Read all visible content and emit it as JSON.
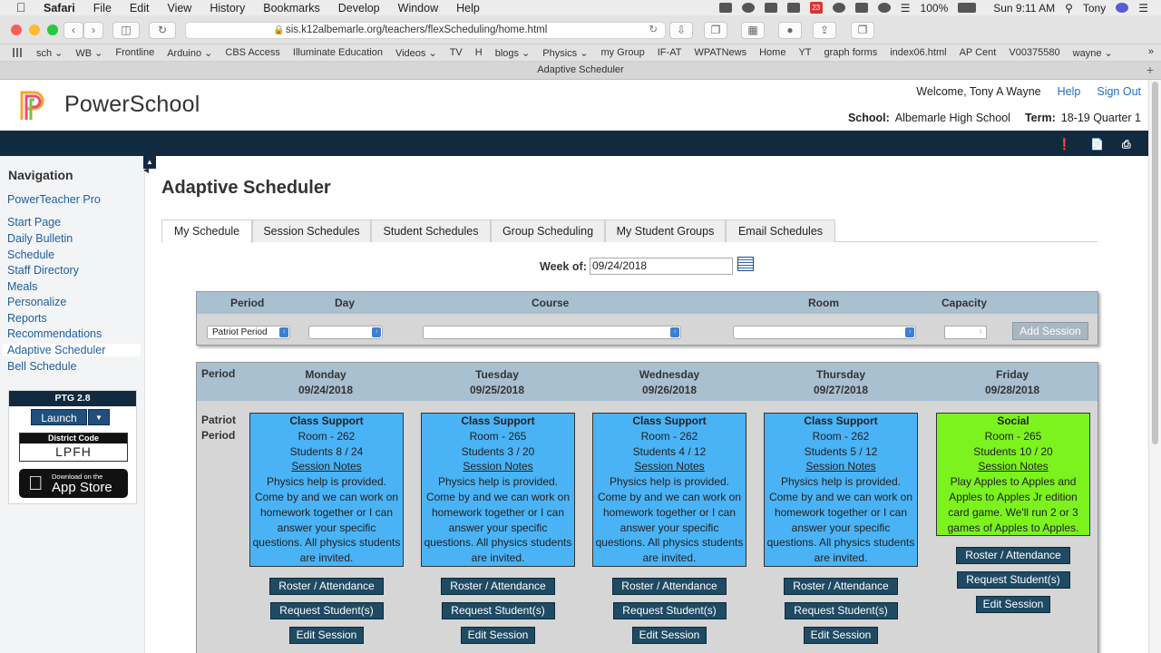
{
  "mac_menu": {
    "app": "Safari",
    "items": [
      "File",
      "Edit",
      "View",
      "History",
      "Bookmarks",
      "Develop",
      "Window",
      "Help"
    ],
    "battery": "100%",
    "clock": "Sun 9:11 AM",
    "user": "Tony",
    "calendar_day": "23"
  },
  "browser": {
    "url": "sis.k12albemarle.org/teachers/flexScheduling/home.html",
    "tab_title": "Adaptive Scheduler",
    "favorites": [
      "sch ⌄",
      "WB ⌄",
      "Frontline",
      "Arduino ⌄",
      "CBS Access",
      "Illuminate Education",
      "Videos ⌄",
      "TV",
      "H",
      "blogs ⌄",
      "Physics ⌄",
      "my Group",
      "IF-AT",
      "WPATNews",
      "Home",
      "YT",
      "graph forms",
      "index06.html",
      "AP Cent",
      "V00375580",
      "wayne ⌄"
    ]
  },
  "header": {
    "logo": "PowerSchool",
    "welcome": "Welcome, Tony A Wayne",
    "help": "Help",
    "signout": "Sign Out",
    "school_label": "School:",
    "school": "Albemarle High School",
    "term_label": "Term:",
    "term": "18-19 Quarter 1"
  },
  "sidebar": {
    "title": "Navigation",
    "pro": "PowerTeacher Pro",
    "items": [
      "Start Page",
      "Daily Bulletin",
      "Schedule",
      "Staff Directory",
      "Meals",
      "Personalize",
      "Reports",
      "Recommendations",
      "Adaptive Scheduler",
      "Bell Schedule"
    ],
    "ptg": {
      "title": "PTG 2.8",
      "launch": "Launch",
      "dropdown": "▼",
      "district_label": "District Code",
      "district_code": "LPFH",
      "store_small": "Download on the",
      "store_big": "App Store"
    }
  },
  "main": {
    "title": "Adaptive Scheduler",
    "tabs": [
      "My Schedule",
      "Session Schedules",
      "Student Schedules",
      "Group Scheduling",
      "My Student Groups",
      "Email Schedules"
    ],
    "week_label": "Week of:",
    "week_value": "09/24/2018"
  },
  "add_session": {
    "headers": [
      "Period",
      "Day",
      "Course",
      "Room",
      "Capacity"
    ],
    "period_value": "Patriot Period",
    "add_button": "Add Session"
  },
  "schedule": {
    "period_header": "Period",
    "period_name": [
      "Patriot",
      "Period"
    ],
    "days": [
      {
        "day": "Monday",
        "date": "09/24/2018",
        "title": "Class Support",
        "room": "Room - 262",
        "students": "Students 8 / 24",
        "notes_link": "Session Notes",
        "desc": [
          "Physics help is provided.",
          "Come by and we can work on",
          "homework together or I can",
          "answer your specific",
          "questions. All physics students",
          "are invited."
        ],
        "color": "#4ab3f5"
      },
      {
        "day": "Tuesday",
        "date": "09/25/2018",
        "title": "Class Support",
        "room": "Room - 265",
        "students": "Students 3 / 20",
        "notes_link": "Session Notes",
        "desc": [
          "Physics help is provided.",
          "Come by and we can work on",
          "homework together or I can",
          "answer your specific",
          "questions. All physics students",
          "are invited."
        ],
        "color": "#4ab3f5"
      },
      {
        "day": "Wednesday",
        "date": "09/26/2018",
        "title": "Class Support",
        "room": "Room - 262",
        "students": "Students 4 / 12",
        "notes_link": "Session Notes",
        "desc": [
          "Physics help is provided.",
          "Come by and we can work on",
          "homework together or I can",
          "answer your specific",
          "questions. All physics students",
          "are invited."
        ],
        "color": "#4ab3f5"
      },
      {
        "day": "Thursday",
        "date": "09/27/2018",
        "title": "Class Support",
        "room": "Room - 262",
        "students": "Students 5 / 12",
        "notes_link": "Session Notes",
        "desc": [
          "Physics help is provided.",
          "Come by and we can work on",
          "homework together or I can",
          "answer your specific",
          "questions. All physics students",
          "are invited."
        ],
        "color": "#4ab3f5"
      },
      {
        "day": "Friday",
        "date": "09/28/2018",
        "title": "Social",
        "room": "Room - 265",
        "students": "Students 10 / 20",
        "notes_link": "Session Notes",
        "desc": [
          "Play Apples to Apples and",
          "Apples to Apples Jr edition",
          "card game. We'll run 2 or 3",
          "games of Apples to Apples."
        ],
        "color": "#7cf21e"
      }
    ],
    "buttons": {
      "roster": "Roster / Attendance",
      "request": "Request Student(s)",
      "edit": "Edit Session"
    }
  }
}
